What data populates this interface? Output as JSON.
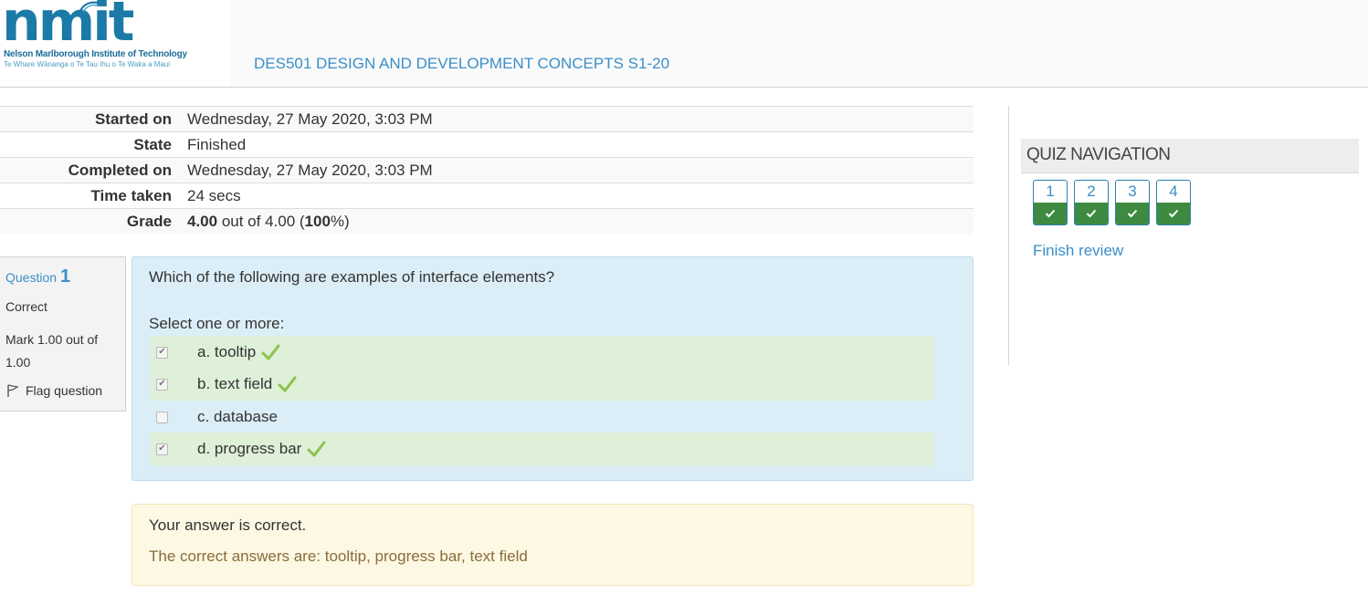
{
  "header": {
    "logo_mark": "nmit",
    "logo_line1": "Nelson Marlborough Institute of Technology",
    "logo_line2": "Te Whare Wānanga o Te Tau Ihu o Te Waka a Maui",
    "course_title": "DES501 DESIGN AND DEVELOPMENT CONCEPTS S1-20",
    "brand_color": "#1b7aa7"
  },
  "summary": {
    "rows": [
      {
        "label": "Started on",
        "value": "Wednesday, 27 May 2020, 3:03 PM"
      },
      {
        "label": "State",
        "value": "Finished"
      },
      {
        "label": "Completed on",
        "value": "Wednesday, 27 May 2020, 3:03 PM"
      },
      {
        "label": "Time taken",
        "value": "24 secs"
      }
    ],
    "grade": {
      "label": "Grade",
      "score": "4.00",
      "out_of_text": " out of 4.00 (",
      "percent": "100",
      "suffix": "%)"
    }
  },
  "question": {
    "info": {
      "label": "Question ",
      "number": "1",
      "state": "Correct",
      "mark": "Mark 1.00 out of 1.00",
      "flag_label": "Flag question",
      "flag_icon": "flag-icon"
    },
    "text": "Which of the following are examples of interface elements?",
    "prompt": "Select one or more:",
    "answers": [
      {
        "label": "a. tooltip",
        "checked": true,
        "correct": true
      },
      {
        "label": "b. text field",
        "checked": true,
        "correct": true
      },
      {
        "label": "c. database",
        "checked": false,
        "correct": false
      },
      {
        "label": "d. progress bar",
        "checked": true,
        "correct": true
      }
    ],
    "correct_tick_color": "#8bc34a"
  },
  "feedback": {
    "general": "Your answer is correct.",
    "right_answer": "The correct answers are: tooltip, progress bar, text field"
  },
  "quiz_nav": {
    "title": "QUIZ NAVIGATION",
    "buttons": [
      {
        "number": "1",
        "state": "correct"
      },
      {
        "number": "2",
        "state": "correct"
      },
      {
        "number": "3",
        "state": "correct"
      },
      {
        "number": "4",
        "state": "correct"
      }
    ],
    "finish_review": "Finish review",
    "correct_color": "#3e8a40"
  }
}
